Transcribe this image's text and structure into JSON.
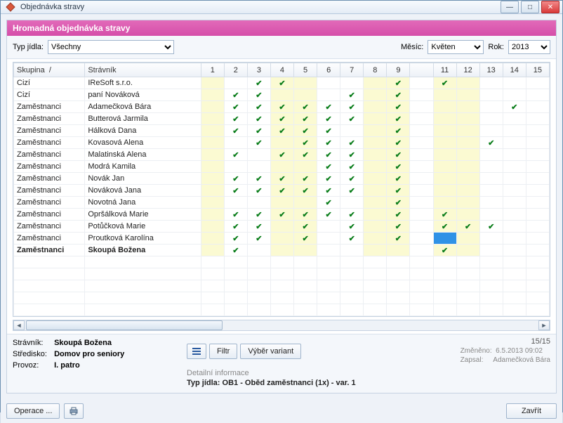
{
  "window": {
    "title": "Objednávka stravy"
  },
  "banner": "Hromadná objednávka stravy",
  "filters": {
    "mealtype_label": "Typ jídla:",
    "mealtype_value": "Všechny",
    "month_label": "Měsíc:",
    "month_value": "Květen",
    "year_label": "Rok:",
    "year_value": "2013"
  },
  "columns": {
    "group": "Skupina",
    "name": "Strávník",
    "days": [
      "1",
      "2",
      "3",
      "4",
      "5",
      "6",
      "7",
      "8",
      "9",
      "",
      "11",
      "12",
      "13",
      "14",
      "15"
    ]
  },
  "highlight_days": [
    1,
    4,
    5,
    8,
    9,
    11,
    12
  ],
  "selected": {
    "row": 14,
    "day": 11
  },
  "rows": [
    {
      "group": "Cizí",
      "name": "IReSoft s.r.o.",
      "checks": [
        3,
        4,
        9,
        11
      ]
    },
    {
      "group": "Cizí",
      "name": "paní Nováková",
      "checks": [
        2,
        3,
        7,
        9
      ]
    },
    {
      "group": "Zaměstnanci",
      "name": "Adamečková Bára",
      "checks": [
        2,
        3,
        4,
        5,
        6,
        7,
        9,
        14
      ]
    },
    {
      "group": "Zaměstnanci",
      "name": "Butterová Jarmila",
      "checks": [
        2,
        3,
        4,
        5,
        6,
        7,
        9
      ]
    },
    {
      "group": "Zaměstnanci",
      "name": "Hálková Dana",
      "checks": [
        2,
        3,
        4,
        5,
        6,
        9
      ]
    },
    {
      "group": "Zaměstnanci",
      "name": "Kovasová Alena",
      "checks": [
        3,
        5,
        6,
        7,
        9,
        13
      ]
    },
    {
      "group": "Zaměstnanci",
      "name": "Malatinská Alena",
      "checks": [
        2,
        4,
        5,
        6,
        7,
        9
      ]
    },
    {
      "group": "Zaměstnanci",
      "name": "Modrá Kamila",
      "checks": [
        6,
        7,
        9
      ]
    },
    {
      "group": "Zaměstnanci",
      "name": "Novák Jan",
      "checks": [
        2,
        3,
        4,
        5,
        6,
        7,
        9
      ]
    },
    {
      "group": "Zaměstnanci",
      "name": "Nováková Jana",
      "checks": [
        2,
        3,
        4,
        5,
        6,
        7,
        9
      ]
    },
    {
      "group": "Zaměstnanci",
      "name": "Novotná Jana",
      "checks": [
        6,
        9
      ]
    },
    {
      "group": "Zaměstnanci",
      "name": "Opršálková Marie",
      "checks": [
        2,
        3,
        4,
        5,
        6,
        7,
        9,
        11
      ]
    },
    {
      "group": "Zaměstnanci",
      "name": "Potůčková Marie",
      "checks": [
        2,
        3,
        5,
        7,
        9,
        11,
        12,
        13
      ]
    },
    {
      "group": "Zaměstnanci",
      "name": "Proutková Karolína",
      "checks": [
        2,
        3,
        5,
        7,
        9
      ]
    },
    {
      "group": "Zaměstnanci",
      "name": "Skoupá Božena",
      "checks": [
        2,
        11
      ]
    }
  ],
  "detail": {
    "stravnik_label": "Strávník:",
    "stravnik": "Skoupá Božena",
    "stredisko_label": "Středisko:",
    "stredisko": "Domov pro seniory",
    "provoz_label": "Provoz:",
    "provoz": "I. patro",
    "filter_btn": "Filtr",
    "variants_btn": "Výběr variant",
    "detail_info": "Detailní informace",
    "type_label": "Typ jídla:",
    "type_value": "OB1 - Oběd zaměstnanci (1x) - var. 1",
    "changed_label": "Změněno:",
    "changed_value": "6.5.2013 09:02",
    "author_label": "Zapsal:",
    "author_value": "Adamečková Bára",
    "count": "15/15"
  },
  "buttons": {
    "operations": "Operace ...",
    "close": "Zavřít"
  }
}
